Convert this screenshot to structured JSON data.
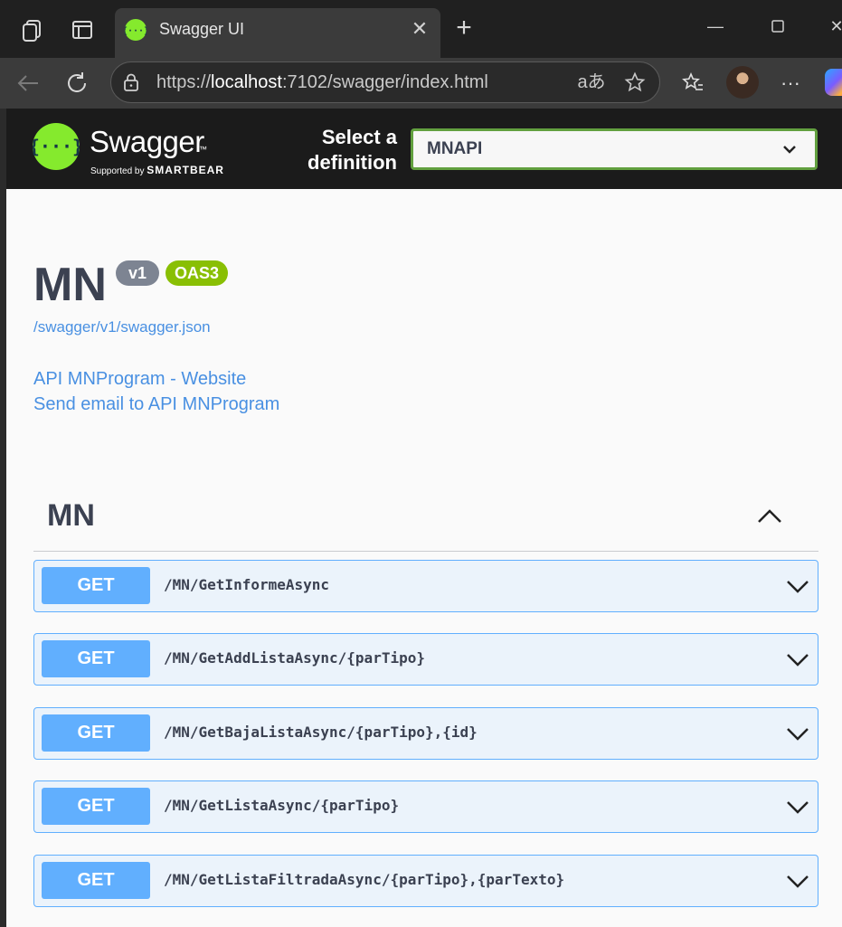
{
  "browser": {
    "tab_title": "Swagger UI",
    "url_prefix": "https://",
    "url_host": "localhost",
    "url_rest": ":7102/swagger/index.html",
    "icons": [
      "workspaces-icon",
      "tab-actions-icon",
      "back-icon",
      "refresh-icon",
      "lock-icon",
      "read-aloud-icon",
      "favorite-star-icon",
      "favorites-icon",
      "profile-avatar",
      "more-icon",
      "copilot-icon"
    ]
  },
  "swagger": {
    "brand": "Swagger",
    "tm": "™",
    "supported_by": "Supported by",
    "smartbear": "SMARTBEAR",
    "definition_label": "Select a definition",
    "definition_value": "MNAPI"
  },
  "info": {
    "title": "MN",
    "version_badge": "v1",
    "oas_badge": "OAS3",
    "spec_url": "/swagger/v1/swagger.json",
    "website_link": "API MNProgram - Website",
    "email_link": "Send email to API MNProgram"
  },
  "tag": {
    "name": "MN"
  },
  "operations": [
    {
      "method": "GET",
      "path": "/MN/GetInformeAsync"
    },
    {
      "method": "GET",
      "path": "/MN/GetAddListaAsync/{parTipo}"
    },
    {
      "method": "GET",
      "path": "/MN/GetBajaListaAsync/{parTipo},{id}"
    },
    {
      "method": "GET",
      "path": "/MN/GetListaAsync/{parTipo}"
    },
    {
      "method": "GET",
      "path": "/MN/GetListaFiltradaAsync/{parTipo},{parTexto}"
    }
  ],
  "colors": {
    "get_accent": "#61affe",
    "get_background": "#ebf3fb",
    "swagger_green": "#85ea2d",
    "link": "#4990e2"
  }
}
